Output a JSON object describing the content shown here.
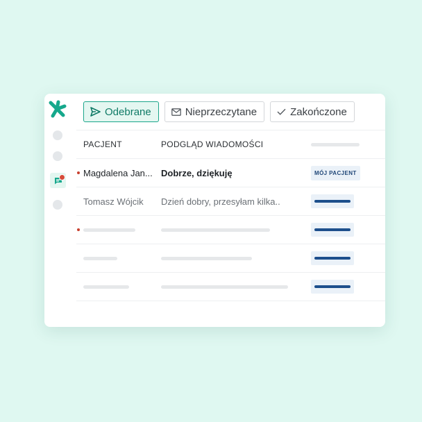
{
  "colors": {
    "background": "#dff8f1",
    "accent": "#1aa58a",
    "unread": "#c8402f",
    "tag": "#1d4f8c"
  },
  "sidebar": {
    "logo_icon": "docplanner-logo-icon",
    "items": [
      {
        "icon": "nav-placeholder-icon"
      },
      {
        "icon": "nav-placeholder-icon"
      },
      {
        "icon": "messages-icon",
        "active": true,
        "has_notification": true
      },
      {
        "icon": "nav-placeholder-icon"
      }
    ]
  },
  "tabs": [
    {
      "label": "Odebrane",
      "icon": "send-icon",
      "active": true
    },
    {
      "label": "Nieprzeczytane",
      "icon": "envelope-icon",
      "active": false
    },
    {
      "label": "Zakończone",
      "icon": "checkmark-icon",
      "active": false
    }
  ],
  "table": {
    "headers": {
      "patient": "PACJENT",
      "preview": "PODGLĄD WIADOMOŚCI"
    },
    "rows": [
      {
        "patient": "Magdalena Jan...",
        "preview": "Dobrze, dziękuję",
        "tag": "MÓJ PACJENT",
        "unread": true
      },
      {
        "patient": "Tomasz Wójcik",
        "preview": "Dzień dobry, przesyłam kilka..",
        "unread": false
      }
    ]
  }
}
